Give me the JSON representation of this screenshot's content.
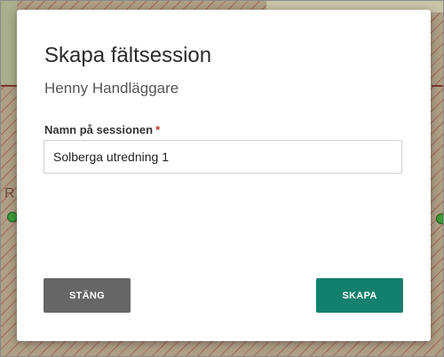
{
  "background": {
    "map_letter": "R"
  },
  "dialog": {
    "title": "Skapa fältsession",
    "subtitle": "Henny Handläggare",
    "field_label": "Namn på sessionen",
    "required_marker": "*",
    "session_name_value": "Solberga utredning 1",
    "close_label": "STÄNG",
    "create_label": "SKAPA"
  },
  "colors": {
    "create_button": "#11806d",
    "close_button": "#666666",
    "required_marker": "#c0392b"
  }
}
